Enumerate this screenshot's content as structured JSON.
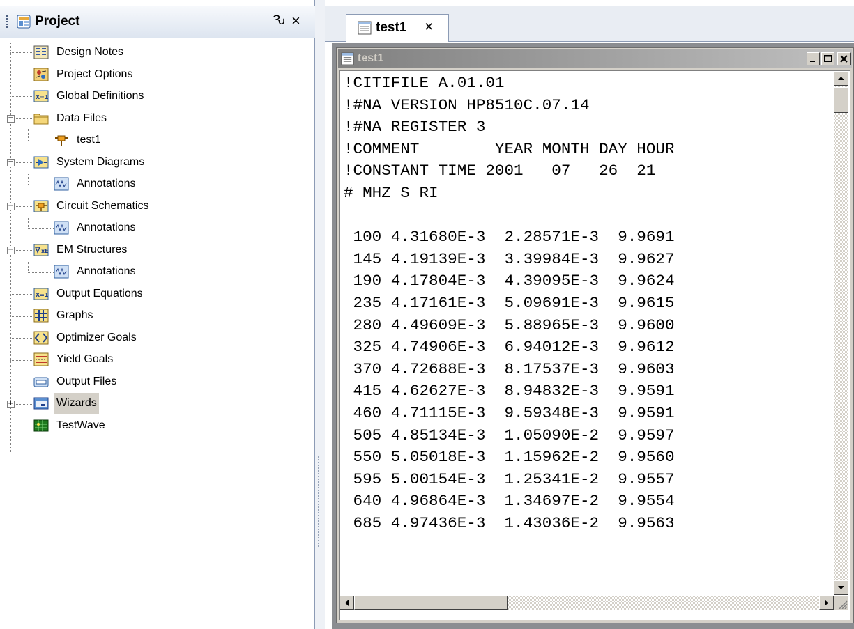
{
  "project_pane": {
    "title": "Project",
    "pin_glyph": "Ԅ",
    "close_glyph": "×",
    "tree": [
      {
        "label": "Design Notes",
        "icon": "design-notes-icon"
      },
      {
        "label": "Project Options",
        "icon": "project-options-icon"
      },
      {
        "label": "Global Definitions",
        "icon": "global-definitions-icon"
      },
      {
        "label": "Data Files",
        "icon": "folder-icon",
        "expanded": true
      },
      {
        "label": "test1",
        "icon": "data-file-icon"
      },
      {
        "label": "System Diagrams",
        "icon": "system-diagram-icon",
        "expanded": true
      },
      {
        "label": "Annotations",
        "icon": "annotations-icon"
      },
      {
        "label": "Circuit Schematics",
        "icon": "circuit-schematic-icon",
        "expanded": true
      },
      {
        "label": "Annotations",
        "icon": "annotations-icon"
      },
      {
        "label": "EM Structures",
        "icon": "em-structures-icon",
        "expanded": true
      },
      {
        "label": "Annotations",
        "icon": "annotations-icon"
      },
      {
        "label": "Output Equations",
        "icon": "output-equations-icon"
      },
      {
        "label": "Graphs",
        "icon": "graphs-icon"
      },
      {
        "label": "Optimizer Goals",
        "icon": "optimizer-goals-icon"
      },
      {
        "label": "Yield Goals",
        "icon": "yield-goals-icon"
      },
      {
        "label": "Output Files",
        "icon": "output-files-icon"
      },
      {
        "label": "Wizards",
        "icon": "wizards-icon",
        "expanded": false,
        "selected": true
      },
      {
        "label": "TestWave",
        "icon": "testwave-icon"
      }
    ]
  },
  "document": {
    "tab_label": "test1",
    "tab_close_glyph": "×",
    "window_title": "test1",
    "lines": [
      "!CITIFILE A.01.01",
      "!#NA VERSION HP8510C.07.14",
      "!#NA REGISTER 3",
      "!COMMENT        YEAR MONTH DAY HOUR",
      "!CONSTANT TIME 2001   07   26  21",
      "# MHZ S RI",
      "",
      " 100 4.31680E-3  2.28571E-3  9.9691",
      " 145 4.19139E-3  3.39984E-3  9.9627",
      " 190 4.17804E-3  4.39095E-3  9.9624",
      " 235 4.17161E-3  5.09691E-3  9.9615",
      " 280 4.49609E-3  5.88965E-3  9.9600",
      " 325 4.74906E-3  6.94012E-3  9.9612",
      " 370 4.72688E-3  8.17537E-3  9.9603",
      " 415 4.62627E-3  8.94832E-3  9.9591",
      " 460 4.71115E-3  9.59348E-3  9.9591",
      " 505 4.85134E-3  1.05090E-2  9.9597",
      " 550 5.05018E-3  1.15962E-2  9.9560",
      " 595 5.00154E-3  1.25341E-2  9.9557",
      " 640 4.96864E-3  1.34697E-2  9.9554",
      " 685 4.97436E-3  1.43036E-2  9.9563"
    ]
  },
  "colors": {
    "pane_header": "#dde5f0",
    "border": "#8c9bb5",
    "mdi_background": "#8b8d91",
    "window_face": "#d4d0c8",
    "inactive_title": "#808080"
  }
}
